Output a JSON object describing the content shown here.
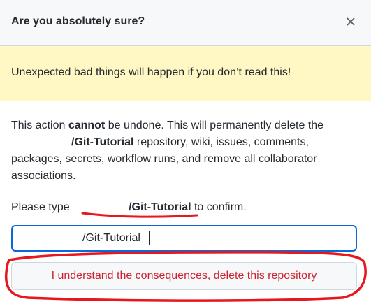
{
  "dialog": {
    "title": "Are you absolutely sure?",
    "close_icon": "close-icon"
  },
  "warning": {
    "text": "Unexpected bad things will happen if you don’t read this!"
  },
  "body": {
    "line1_prefix": "This action ",
    "line1_bold": "cannot",
    "line1_suffix": " be undone. This will permanently delete the",
    "repo_name": "/Git-Tutorial",
    "line2_suffix": " repository, wiki, issues, comments, packages, secrets, workflow runs, and remove all collaborator associations."
  },
  "confirm": {
    "prefix": "Please type ",
    "repo_name": "/Git-Tutorial",
    "suffix": " to confirm."
  },
  "input": {
    "value": "/Git-Tutorial"
  },
  "delete_button": {
    "label": "I understand the consequences, delete this repository"
  },
  "annotation": {
    "color": "#e8161d"
  }
}
